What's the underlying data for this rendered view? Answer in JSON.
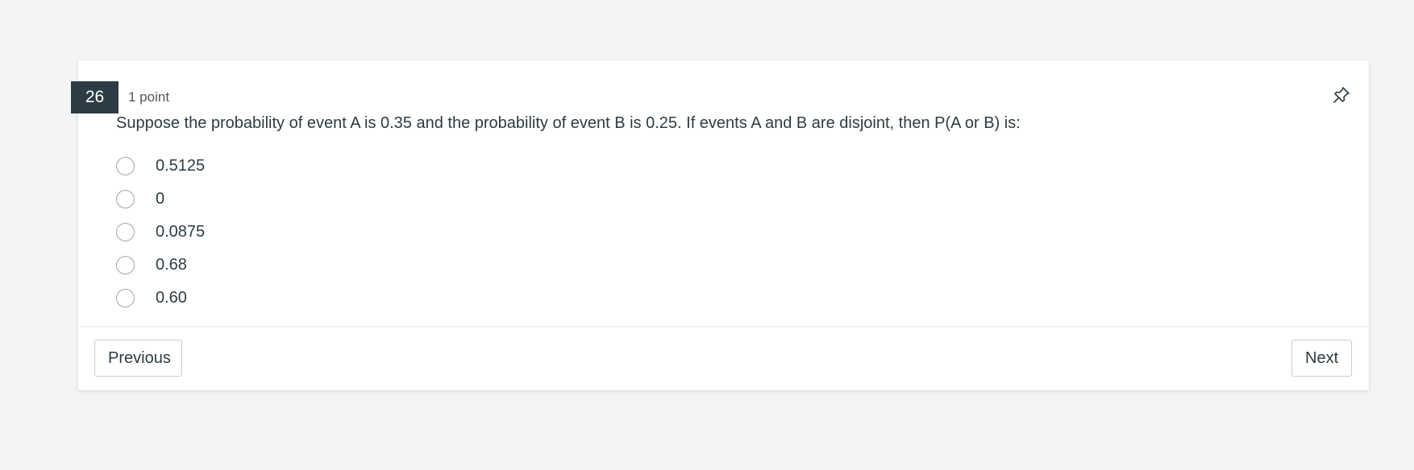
{
  "question": {
    "number": "26",
    "points": "1 point",
    "text": "Suppose the probability of event A is 0.35 and the probability of event B is 0.25. If events A and B are disjoint, then P(A or B) is:",
    "pin_icon": "pin-icon"
  },
  "answers": [
    {
      "label": "0.5125",
      "selected": false
    },
    {
      "label": "0",
      "selected": false
    },
    {
      "label": "0.0875",
      "selected": false
    },
    {
      "label": "0.68",
      "selected": false
    },
    {
      "label": "0.60",
      "selected": false
    }
  ],
  "navigation": {
    "previous_label": "Previous",
    "next_label": "Next"
  },
  "colors": {
    "page_background": "#f4f4f4",
    "card_background": "#ffffff",
    "number_badge": "#2d3b45",
    "text": "#2d3b45"
  }
}
